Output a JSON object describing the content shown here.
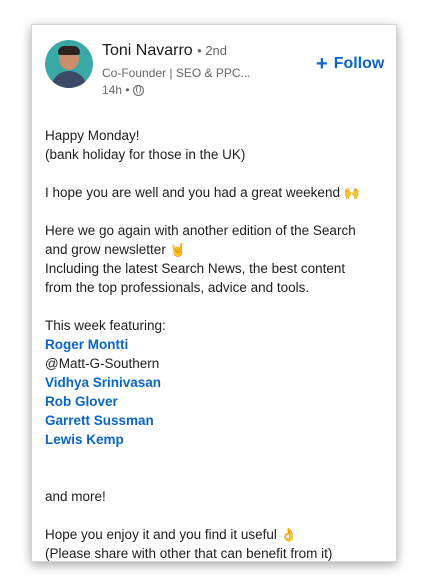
{
  "author": {
    "name": "Toni Navarro",
    "degree": "• 2nd",
    "headline": "Co-Founder | SEO & PPC...",
    "time": "14h •"
  },
  "follow_label": "Follow",
  "post": {
    "greeting": "Happy Monday!",
    "holiday": "(bank holiday for those in the UK)",
    "hope": "I hope you are well and you had a great weekend",
    "hope_emoji": "🙌",
    "edition_1": "Here we go again with another edition of the Search",
    "edition_2": "and grow newsletter",
    "edition_emoji": "🤘",
    "including_1": "Including the latest Search News, the best content",
    "including_2": "from the top professionals, advice and tools.",
    "featuring": "This week featuring:",
    "mentions": [
      "Roger Montti",
      "Vidhya Srinivasan",
      "Rob Glover",
      "Garrett Sussman",
      "Lewis Kemp"
    ],
    "handle": "@Matt-G-Southern",
    "more": "and more!",
    "enjoy": "Hope you enjoy it and you find it useful",
    "enjoy_emoji": "👌",
    "share": "(Please share with other that can benefit from it)"
  }
}
